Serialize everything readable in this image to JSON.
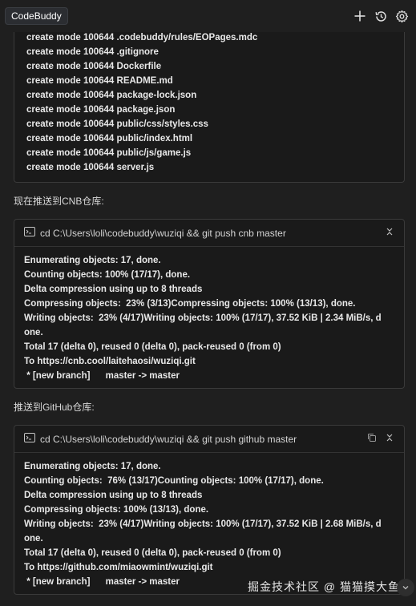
{
  "header": {
    "title": "CodeBuddy",
    "icons": [
      "plus-icon",
      "history-icon",
      "gear-icon"
    ]
  },
  "partial_terminal": {
    "lines": [
      "create mode 100644 .codebuddy/rules/EOPages.mdc",
      "create mode 100644 .gitignore",
      "create mode 100644 Dockerfile",
      "create mode 100644 README.md",
      "create mode 100644 package-lock.json",
      "create mode 100644 package.json",
      "create mode 100644 public/css/styles.css",
      "create mode 100644 public/index.html",
      "create mode 100644 public/js/game.js",
      "create mode 100644 server.js"
    ]
  },
  "msg_cnb": "现在推送到CNB仓库:",
  "terminal_cnb": {
    "command": "cd C:\\Users\\loli\\codebuddy\\wuziqi && git push cnb master",
    "lines": [
      "Enumerating objects: 17, done.",
      "Counting objects: 100% (17/17), done.",
      "Delta compression using up to 8 threads",
      "Compressing objects:  23% (3/13)Compressing objects: 100% (13/13), done.",
      "Writing objects:  23% (4/17)Writing objects: 100% (17/17), 37.52 KiB | 2.34 MiB/s, d",
      "one.",
      "Total 17 (delta 0), reused 0 (delta 0), pack-reused 0 (from 0)",
      "To https://cnb.cool/laitehaosi/wuziqi.git",
      " * [new branch]      master -> master"
    ]
  },
  "msg_gh": "推送到GitHub仓库:",
  "terminal_gh": {
    "command": "cd C:\\Users\\loli\\codebuddy\\wuziqi && git push github master",
    "lines": [
      "Enumerating objects: 17, done.",
      "Counting objects:  76% (13/17)Counting objects: 100% (17/17), done.",
      "Delta compression using up to 8 threads",
      "Compressing objects: 100% (13/13), done.",
      "Writing objects:  23% (4/17)Writing objects: 100% (17/17), 37.52 KiB | 2.68 MiB/s, d",
      "one.",
      "Total 17 (delta 0), reused 0 (delta 0), pack-reused 0 (from 0)",
      "To https://github.com/miaowmint/wuziqi.git",
      " * [new branch]      master -> master"
    ]
  },
  "watermark": "掘金技术社区 @ 猫猫摸大鱼"
}
